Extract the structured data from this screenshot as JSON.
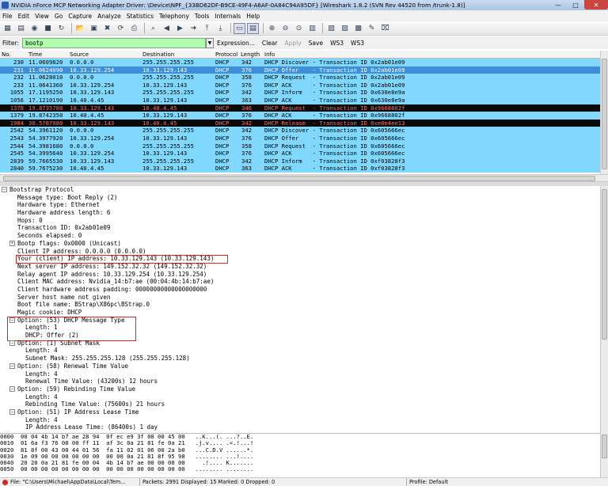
{
  "window": {
    "title": "NVIDIA nForce MCP Networking Adapter Driver: \\Device\\NPF_{33BD62DF-B9CE-49F4-A6AF-0A84C94A95DF}   [Wireshark 1.8.2  (SVN Rev 44520 from /trunk-1.8)]",
    "minimize": "—",
    "maximize": "□",
    "close": "✕"
  },
  "menu": [
    "File",
    "Edit",
    "View",
    "Go",
    "Capture",
    "Analyze",
    "Statistics",
    "Telephony",
    "Tools",
    "Internals",
    "Help"
  ],
  "filter": {
    "label": "Filter:",
    "value": "bootp",
    "buttons": [
      "Expression...",
      "Clear",
      "Apply",
      "Save",
      "WS3",
      "WS3"
    ]
  },
  "columns": [
    "No.",
    "Time",
    "Source",
    "Destination",
    "Protocol",
    "Length",
    "Info"
  ],
  "packets": [
    {
      "no": "230",
      "time": "11.0609820",
      "src": "0.0.0.0",
      "dst": "255.255.255.255",
      "proto": "DHCP",
      "len": "342",
      "info": "DHCP Discover - Transaction ID 0x2ab01e09",
      "style": "normal"
    },
    {
      "no": "231",
      "time": "11.0624090",
      "src": "10.33.129.254",
      "dst": "10.33.129.143",
      "proto": "DHCP",
      "len": "376",
      "info": "DHCP Offer    - Transaction ID 0x2ab01e09",
      "style": "selected"
    },
    {
      "no": "232",
      "time": "11.0628010",
      "src": "0.0.0.0",
      "dst": "255.255.255.255",
      "proto": "DHCP",
      "len": "358",
      "info": "DHCP Request  - Transaction ID 0x2ab01e09",
      "style": "normal"
    },
    {
      "no": "233",
      "time": "11.0641360",
      "src": "10.33.129.254",
      "dst": "10.33.129.143",
      "proto": "DHCP",
      "len": "376",
      "info": "DHCP ACK      - Transaction ID 0x2ab01e09",
      "style": "normal"
    },
    {
      "no": "1055",
      "time": "17.1195250",
      "src": "10.33.129.143",
      "dst": "255.255.255.255",
      "proto": "DHCP",
      "len": "342",
      "info": "DHCP Inform   - Transaction ID 0x630e8e9a",
      "style": "normal"
    },
    {
      "no": "1056",
      "time": "17.1210190",
      "src": "10.40.4.45",
      "dst": "10.33.129.143",
      "proto": "DHCP",
      "len": "363",
      "info": "DHCP ACK      - Transaction ID 0x630e8e9a",
      "style": "normal"
    },
    {
      "no": "1378",
      "time": "19.8735780",
      "src": "10.33.129.143",
      "dst": "10.40.4.45",
      "proto": "DHCP",
      "len": "346",
      "info": "DHCP Request  - Transaction ID 0x9668802f",
      "style": "black"
    },
    {
      "no": "1379",
      "time": "19.8742350",
      "src": "10.40.4.45",
      "dst": "10.33.129.143",
      "proto": "DHCP",
      "len": "376",
      "info": "DHCP ACK      - Transaction ID 0x9668802f",
      "style": "normal"
    },
    {
      "no": "1984",
      "time": "30.5787980",
      "src": "10.33.129.143",
      "dst": "10.40.4.45",
      "proto": "DHCP",
      "len": "342",
      "info": "DHCP Release  - Transaction ID 0xe0e4ee13",
      "style": "black"
    },
    {
      "no": "2542",
      "time": "54.3961120",
      "src": "0.0.0.0",
      "dst": "255.255.255.255",
      "proto": "DHCP",
      "len": "342",
      "info": "DHCP Discover - Transaction ID 0x605666ec",
      "style": "normal"
    },
    {
      "no": "2543",
      "time": "54.3977920",
      "src": "10.33.129.254",
      "dst": "10.33.129.143",
      "proto": "DHCP",
      "len": "376",
      "info": "DHCP Offer    - Transaction ID 0x605666ec",
      "style": "normal"
    },
    {
      "no": "2544",
      "time": "54.3981680",
      "src": "0.0.0.0",
      "dst": "255.255.255.255",
      "proto": "DHCP",
      "len": "358",
      "info": "DHCP Request  - Transaction ID 0x605666ec",
      "style": "normal"
    },
    {
      "no": "2545",
      "time": "54.3995640",
      "src": "10.33.129.254",
      "dst": "10.33.129.143",
      "proto": "DHCP",
      "len": "376",
      "info": "DHCP ACK      - Transaction ID 0x605666ec",
      "style": "normal"
    },
    {
      "no": "2839",
      "time": "59.7665530",
      "src": "10.33.129.143",
      "dst": "255.255.255.255",
      "proto": "DHCP",
      "len": "342",
      "info": "DHCP Inform   - Transaction ID 0xf03828f3",
      "style": "normal"
    },
    {
      "no": "2840",
      "time": "59.7675230",
      "src": "10.40.4.45",
      "dst": "10.33.129.143",
      "proto": "DHCP",
      "len": "363",
      "info": "DHCP ACK      - Transaction ID 0xf03828f3",
      "style": "normal"
    }
  ],
  "details": [
    {
      "text": "Bootstrap Protocol",
      "level": 0,
      "toggle": "−"
    },
    {
      "text": "Message type: Boot Reply (2)",
      "level": 2
    },
    {
      "text": "Hardware type: Ethernet",
      "level": 2
    },
    {
      "text": "Hardware address length: 6",
      "level": 2
    },
    {
      "text": "Hops: 0",
      "level": 2
    },
    {
      "text": "Transaction ID: 0x2ab01e09",
      "level": 2
    },
    {
      "text": "Seconds elapsed: 0",
      "level": 2
    },
    {
      "text": "Bootp flags: 0x0000 (Unicast)",
      "level": 2,
      "toggle": "+"
    },
    {
      "text": "Client IP address: 0.0.0.0 (0.0.0.0)",
      "level": 2
    },
    {
      "text": "Your (client) IP address: 10.33.129.143 (10.33.129.143)",
      "level": 2
    },
    {
      "text": "Next server IP address: 149.152.32.32 (149.152.32.32)",
      "level": 2
    },
    {
      "text": "Relay agent IP address: 10.33.129.254 (10.33.129.254)",
      "level": 2
    },
    {
      "text": "Client MAC address: Nvidia_14:b7:ae (00:04:4b:14:b7:ae)",
      "level": 2
    },
    {
      "text": "Client hardware address padding: 00000000000000000000",
      "level": 2
    },
    {
      "text": "Server host name not given",
      "level": 2
    },
    {
      "text": "Boot file name: BStrap\\X86pc\\BStrap.0",
      "level": 2
    },
    {
      "text": "Magic cookie: DHCP",
      "level": 2
    },
    {
      "text": "Option: (53) DHCP Message Type",
      "level": 2,
      "toggle": "−"
    },
    {
      "text": "Length: 1",
      "level": 4
    },
    {
      "text": "DHCP: Offer (2)",
      "level": 4
    },
    {
      "text": "Option: (1) Subnet Mask",
      "level": 2,
      "toggle": "−"
    },
    {
      "text": "Length: 4",
      "level": 4
    },
    {
      "text": "Subnet Mask: 255.255.255.128 (255.255.255.128)",
      "level": 4
    },
    {
      "text": "Option: (58) Renewal Time Value",
      "level": 2,
      "toggle": "−"
    },
    {
      "text": "Length: 4",
      "level": 4
    },
    {
      "text": "Renewal Time Value: (43200s) 12 hours",
      "level": 4
    },
    {
      "text": "Option: (59) Rebinding Time Value",
      "level": 2,
      "toggle": "−"
    },
    {
      "text": "Length: 4",
      "level": 4
    },
    {
      "text": "Rebinding Time Value: (75600s) 21 hours",
      "level": 4
    },
    {
      "text": "Option: (51) IP Address Lease Time",
      "level": 2,
      "toggle": "−"
    },
    {
      "text": "Length: 4",
      "level": 4
    },
    {
      "text": "IP Address Lease Time: (86400s) 1 day",
      "level": 4
    }
  ],
  "hex": [
    "0000  00 04 4b 14 b7 ae 28 94  0f ec e9 3f 08 00 45 00   ..K...(. ...?..E.",
    "0010  01 6a f3 76 00 00 ff 11  af 3c 0a 21 81 fe 0a 21   .j.v.... .<.!...!",
    "0020  81 8f 00 43 00 44 01 56  fa 11 02 01 06 00 2a b0   ...C.D.V ......*.",
    "0030  1e 09 00 00 00 00 00 00  00 00 0a 21 81 8f 95 98   ........ ...!....",
    "0040  20 20 0a 21 81 fe 00 04  4b 14 b7 ae 00 00 00 00     .!.... K.......",
    "0050  00 00 00 00 00 00 00 00  00 00 00 00 00 00 00 00   ........ ........"
  ],
  "status": {
    "file": "File: \"C:\\Users\\Michael\\AppData\\Local\\Tem...",
    "packets": "Packets: 2991 Displayed: 15 Marked: 0 Dropped: 0",
    "profile": "Profile: Default"
  },
  "colors": {
    "row_normal": "#80d8ff",
    "row_selected": "#3c8fd8",
    "row_black": "#0a0a0a",
    "row_black_text": "#ff6a6a",
    "filter_ok": "#afffaf",
    "highlight_box": "#dd2222"
  }
}
